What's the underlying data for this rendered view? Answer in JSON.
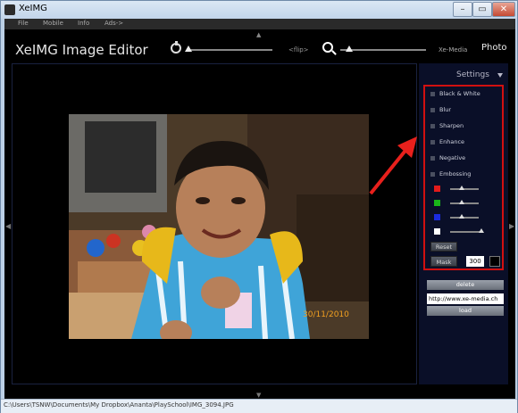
{
  "window": {
    "title": "XeIMG",
    "min": "–",
    "max": "▭",
    "close": "✕"
  },
  "menu": [
    "File",
    "Mobile",
    "Info",
    "Ads->"
  ],
  "toolbar": {
    "app_name": "XeIMG Image Editor",
    "flip_label": "<flip>",
    "xemedia_label": "Xe-Media",
    "photo_label": "Photo"
  },
  "canvas": {
    "date_stamp": "30/11/2010"
  },
  "settings": {
    "label": "Settings",
    "options": [
      "Black & White",
      "Blur",
      "Sharpen",
      "Enhance",
      "Negative",
      "Embossing"
    ],
    "colors": [
      "#e31b1b",
      "#19b519",
      "#1b2be0",
      "#ffffff"
    ],
    "reset_label": "Reset",
    "mask_label": "Mask",
    "mask_value": "300"
  },
  "actions": {
    "delete_label": "delete",
    "url_value": "http://www.xe-media.ch",
    "load_label": "load"
  },
  "status": {
    "path": "C:\\Users\\TSNW\\Documents\\My Dropbox\\Ananta\\PlaySchool\\IMG_3094.JPG"
  },
  "annotation_color": "#e8201c"
}
